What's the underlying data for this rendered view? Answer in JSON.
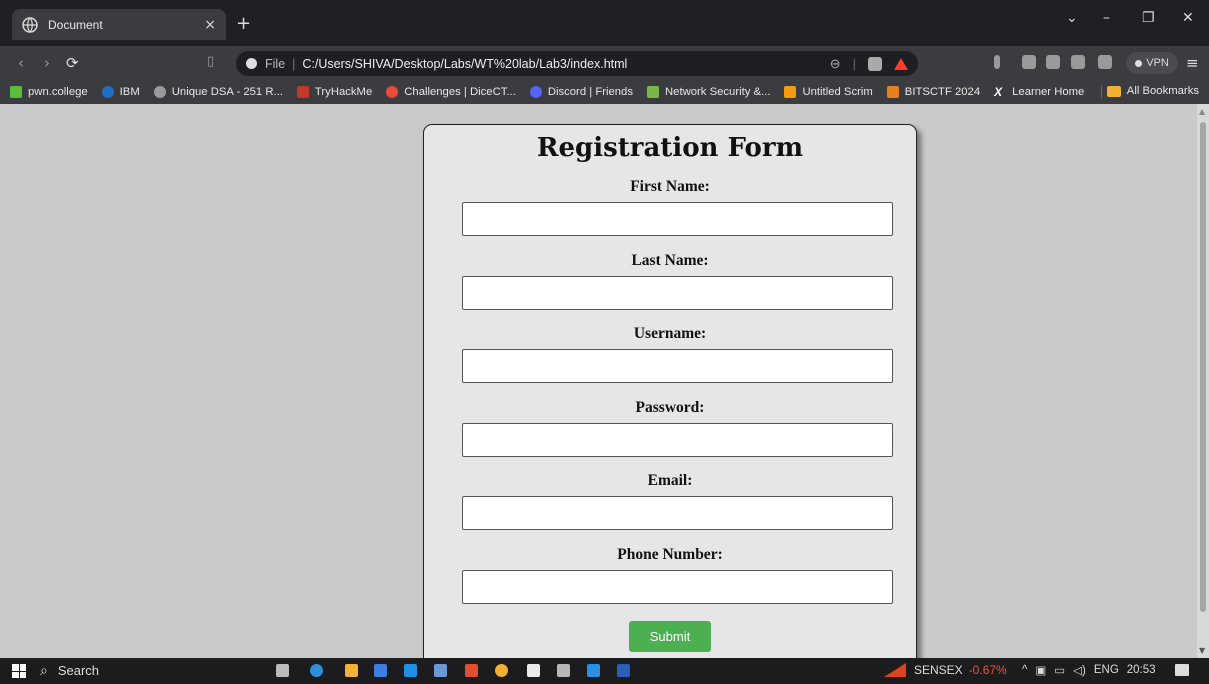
{
  "browser": {
    "tab_title": "Document",
    "tab_close": "×",
    "new_tab": "+",
    "window_controls": [
      "⌄",
      "–",
      "❐",
      "✕"
    ],
    "url_scheme_label": "File",
    "url_path": "C:/Users/SHIVA/Desktop/Labs/WT%20lab/Lab3/index.html",
    "vpn_label": "VPN"
  },
  "bookmarks": [
    {
      "label": "pwn.college",
      "icon": "pwn-college-icon",
      "color": "#5bbd3a"
    },
    {
      "label": "IBM",
      "icon": "ibm-icon",
      "color": "#1f70c1"
    },
    {
      "label": "Unique DSA - 251 R...",
      "icon": "globe-icon",
      "color": "#9a9a9a"
    },
    {
      "label": "TryHackMe",
      "icon": "tryhackme-icon",
      "color": "#c0392b"
    },
    {
      "label": "Challenges | DiceCT...",
      "icon": "dicectf-icon",
      "color": "#e74c3c"
    },
    {
      "label": "Discord | Friends",
      "icon": "discord-icon",
      "color": "#5865f2"
    },
    {
      "label": "Network Security &...",
      "icon": "network-security-icon",
      "color": "#7ab648"
    },
    {
      "label": "Untitled Scrim",
      "icon": "scrimba-icon",
      "color": "#f39c12"
    },
    {
      "label": "BITSCTF 2024",
      "icon": "bitsctf-icon",
      "color": "#e67e22"
    },
    {
      "label": "Learner Home",
      "icon": "edx-icon",
      "color": "#ffffff"
    }
  ],
  "all_bookmarks_label": "All Bookmarks",
  "form": {
    "title": "Registration Form",
    "fields": [
      {
        "label": "First Name:",
        "value": ""
      },
      {
        "label": "Last Name:",
        "value": ""
      },
      {
        "label": "Username:",
        "value": ""
      },
      {
        "label": "Password:",
        "value": ""
      },
      {
        "label": "Email:",
        "value": ""
      },
      {
        "label": "Phone Number:",
        "value": ""
      }
    ],
    "submit_label": "Submit",
    "submit_color": "#4caf50"
  },
  "taskbar": {
    "search_label": "Search",
    "ticker_name": "SENSEX",
    "ticker_change": "-0.67%",
    "language": "ENG",
    "time": "20:53"
  }
}
